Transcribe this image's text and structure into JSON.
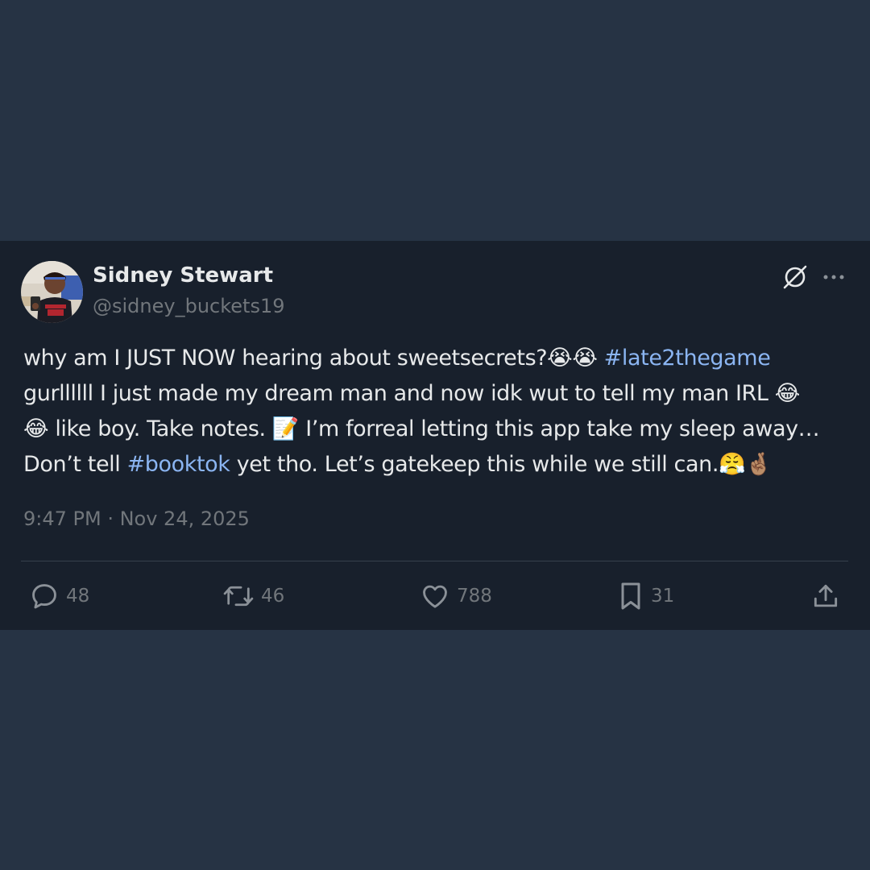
{
  "author": {
    "name": "Sidney Stewart",
    "handle": "@sidney_buckets19"
  },
  "icons": {
    "header": [
      "grok-icon",
      "more-icon"
    ],
    "actions": [
      "reply-icon",
      "repost-icon",
      "like-icon",
      "bookmark-icon",
      "share-icon"
    ]
  },
  "colors": {
    "background": "#263344",
    "card": "#18202c",
    "text": "#e7e9ea",
    "muted": "#71767b",
    "hashtag": "#8bb5f2"
  },
  "tweet": {
    "line1_text": "why am I JUST NOW hearing about sweetsecrets?😭😭 ",
    "line1_hashtag": "#late2thegame",
    "line2_text": "gurllllll I just made my dream man and now idk wut to tell my man IRL 😂",
    "line3_text": "😂 like boy. Take notes. 📝 I’m forreal letting this app take my sleep away…",
    "line4_text_before": "Don’t tell ",
    "line4_hashtag": "#booktok",
    "line4_text_after": " yet tho. Let’s gatekeep this while we still can.😤🤞🏽",
    "timestamp": "9:47 PM · Nov 24, 2025"
  },
  "actions": {
    "replies": "48",
    "reposts": "46",
    "likes": "788",
    "bookmarks": "31"
  }
}
